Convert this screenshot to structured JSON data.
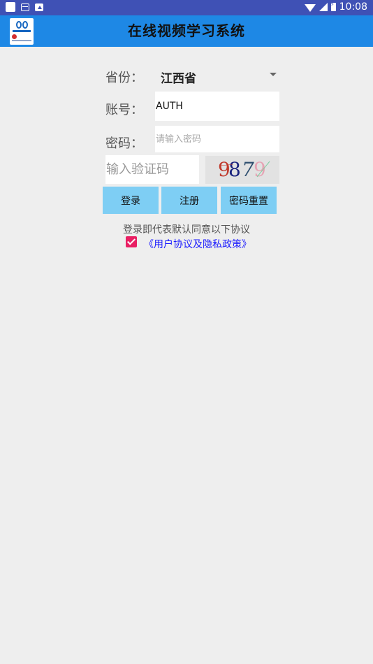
{
  "status_bar": {
    "time": "10:08"
  },
  "app_bar": {
    "title": "在线视频学习系统",
    "logo_icon": "app-logo"
  },
  "form": {
    "province_label": "省份：",
    "province_value": "江西省",
    "account_label": "账号：",
    "account_value": "AUTH",
    "password_label": "密码：",
    "password_placeholder": "请输入密码",
    "captcha_placeholder": "输入验证码",
    "captcha_chars": [
      "9",
      "8",
      "7",
      "9"
    ]
  },
  "buttons": {
    "login": "登录",
    "register": "注册",
    "reset_password": "密码重置"
  },
  "agreement": {
    "text": "登录即代表默认同意以下协议",
    "checked": true,
    "link": "《用户协议及隐私政策》"
  },
  "colors": {
    "status_bar": "#3f51b5",
    "app_bar": "#1e88e5",
    "button": "#7ecef4",
    "checkbox": "#e91e63",
    "link": "#1a1aff"
  }
}
